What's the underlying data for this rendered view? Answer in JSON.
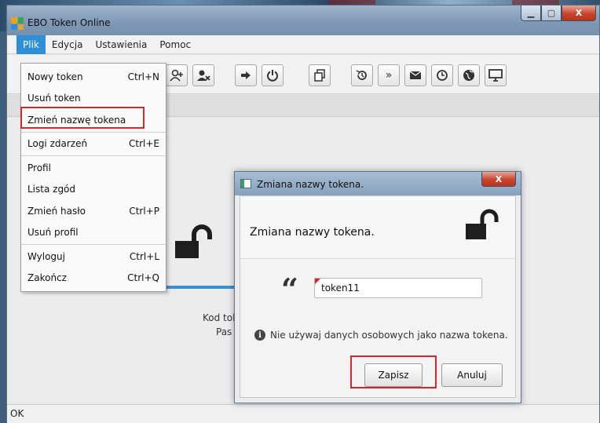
{
  "window": {
    "title": "EBO Token Online",
    "minimize": "▁",
    "maximize": "▢",
    "close": "X"
  },
  "menubar": {
    "items": [
      "Plik",
      "Edycja",
      "Ustawienia",
      "Pomoc"
    ]
  },
  "file_menu": {
    "items": [
      {
        "label": "Nowy token",
        "shortcut": "Ctrl+N"
      },
      {
        "label": "Usuń token",
        "shortcut": ""
      },
      {
        "label": "Zmień nazwę tokena",
        "shortcut": ""
      },
      {
        "label": "Logi zdarzeń",
        "shortcut": "Ctrl+E"
      },
      {
        "label": "Profil",
        "shortcut": ""
      },
      {
        "label": "Lista zgód",
        "shortcut": ""
      },
      {
        "label": "Zmień hasło",
        "shortcut": "Ctrl+P"
      },
      {
        "label": "Usuń profil",
        "shortcut": ""
      },
      {
        "label": "Wyloguj",
        "shortcut": "Ctrl+L"
      },
      {
        "label": "Zakończ",
        "shortcut": "Ctrl+Q"
      }
    ]
  },
  "toolbar": {
    "buttons": [
      "add-user-icon",
      "remove-user-icon",
      "login-icon",
      "power-icon",
      "copy-icon",
      "history-icon",
      "more-icon",
      "mail-icon",
      "clock-icon",
      "globe-icon",
      "monitor-icon"
    ]
  },
  "main": {
    "kod_label": "Kod tok",
    "pas_label": "Pas"
  },
  "status": {
    "text": "OK"
  },
  "dialog": {
    "title": "Zmiana nazwy tokena.",
    "header": "Zmiana nazwy tokena.",
    "close": "X",
    "input_value": "token11",
    "warning": "Nie używaj danych osobowych jako nazwa tokena.",
    "save_label": "Zapisz",
    "cancel_label": "Anuluj"
  },
  "colors": {
    "highlight": "#d9262a",
    "accent": "#2f8ed8"
  }
}
